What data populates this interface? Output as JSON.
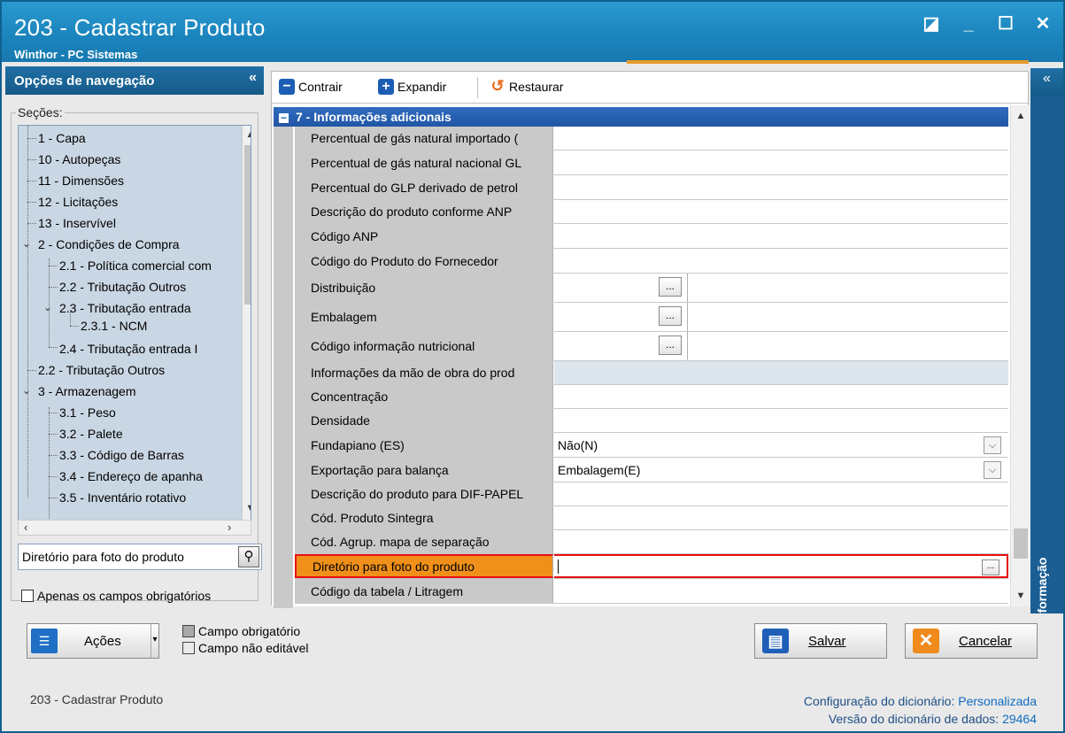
{
  "window": {
    "title": "203 - Cadastrar  Produto",
    "subtitle": "Winthor - PC Sistemas",
    "controls": [
      "◪",
      "_",
      "☐",
      "✕"
    ]
  },
  "nav": {
    "header": "Opções de navegação",
    "collapse": "«",
    "sections_label": "Seções:",
    "tree": [
      "1 - Capa",
      "10 - Autopeças",
      "11 - Dimensões",
      "12 - Licitações",
      "13 - Inservível",
      "2 - Condições de Compra",
      "2.1 - Política comercial com",
      "2.2 - Tributação Outros",
      "2.3 - Tributação entrada",
      "2.3.1 - NCM",
      "2.4 - Tributação entrada I",
      "2.2 - Tributação Outros",
      "3 - Armazenagem",
      "3.1 - Peso",
      "3.2 - Palete",
      "3.3 - Código de Barras",
      "3.4 - Endereço de apanha",
      "3.5 - Inventário rotativo"
    ],
    "search_value": "Diretório para foto do produto",
    "only_required_label": "Apenas os campos obrigatórios"
  },
  "toolbar": {
    "collapse_label": "Contrair",
    "expand_label": "Expandir",
    "restore_label": "Restaurar"
  },
  "grid": {
    "group_title": "7 - Informações adicionais",
    "rows": [
      {
        "label": "Percentual de gás natural importado (",
        "value": ""
      },
      {
        "label": "Percentual de gás natural nacional GL",
        "value": ""
      },
      {
        "label": "Percentual do GLP derivado de petrol",
        "value": ""
      },
      {
        "label": "Descrição do produto conforme ANP",
        "value": ""
      },
      {
        "label": "Código ANP",
        "value": ""
      },
      {
        "label": "Código do Produto do Fornecedor",
        "value": ""
      },
      {
        "label": "Distribuição",
        "value": ""
      },
      {
        "label": "Embalagem",
        "value": ""
      },
      {
        "label": "Código informação nutricional",
        "value": ""
      },
      {
        "label": "Informações da mão de obra do prod",
        "value": ""
      },
      {
        "label": "Concentração",
        "value": ""
      },
      {
        "label": "Densidade",
        "value": ""
      },
      {
        "label": "Fundapiano (ES)",
        "value": "Não(N)"
      },
      {
        "label": "Exportação para balança",
        "value": "Embalagem(E)"
      },
      {
        "label": "Descrição do produto para DIF-PAPEL",
        "value": ""
      },
      {
        "label": "Cód. Produto Sintegra",
        "value": ""
      },
      {
        "label": "Cód. Agrup. mapa de separação",
        "value": ""
      },
      {
        "label": "Diretório para foto do produto",
        "value": ""
      },
      {
        "label": "Código da tabela / Litragem",
        "value": ""
      }
    ],
    "ellipsis": "...",
    "caret_down": "⌵"
  },
  "right_panel": {
    "collapse": "«",
    "title": "Informação"
  },
  "bottom": {
    "actions_label": "Ações",
    "legend_required": "Campo obrigatório",
    "legend_readonly": "Campo não editável",
    "save_label": "Salvar",
    "cancel_label": "Cancelar"
  },
  "footer": {
    "left": "203 - Cadastrar  Produto",
    "dict_config_label": "Configuração do dicionário:",
    "dict_config_value": "Personalizada",
    "dict_version_label": "Versão do dicionário de dados:",
    "dict_version_value": "29464"
  },
  "colors": {
    "title_blue": "#1c85bd",
    "group_blue": "#2156a5",
    "selected_orange": "#f0901a",
    "highlight_red": "#e81010"
  }
}
